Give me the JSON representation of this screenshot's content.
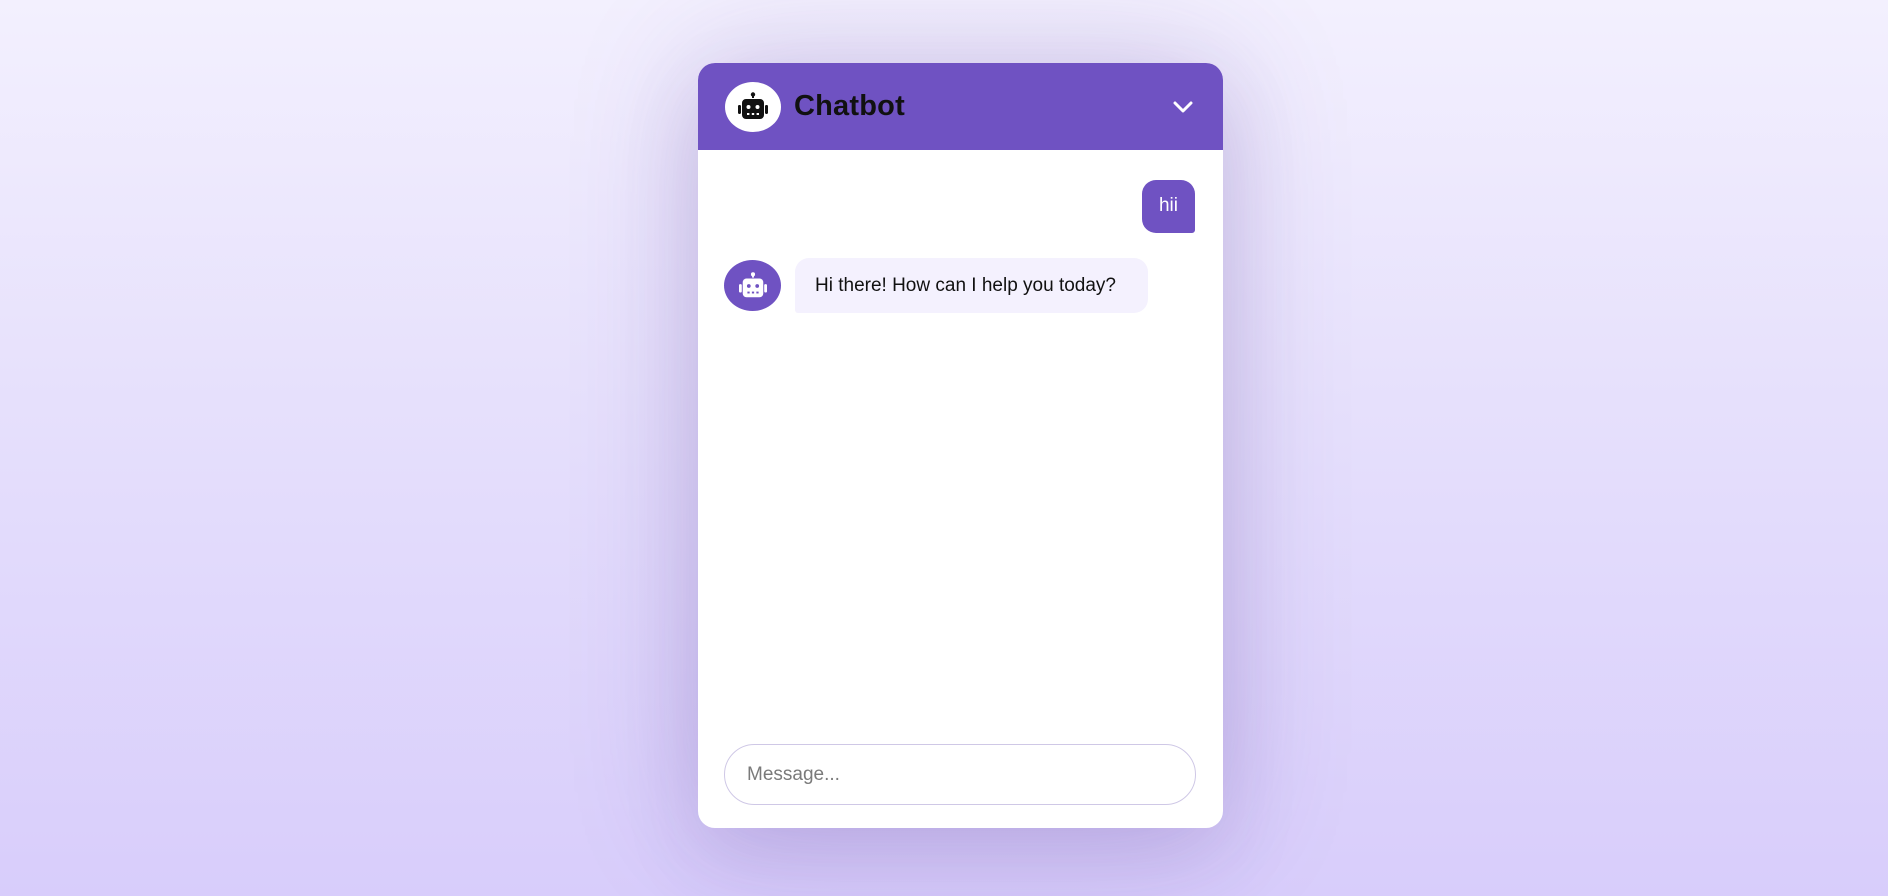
{
  "header": {
    "title": "Chatbot",
    "avatar_icon": "robot-icon",
    "toggle_icon": "chevron-down-icon"
  },
  "messages": [
    {
      "role": "user",
      "text": "hii"
    },
    {
      "role": "bot",
      "text": "Hi there! How can I help you today?",
      "avatar_icon": "robot-icon"
    }
  ],
  "composer": {
    "placeholder": "Message...",
    "value": ""
  },
  "colors": {
    "accent": "#6f52c2",
    "bot_bubble": "#f4f1fe",
    "page_background_top": "#f3f0fe",
    "page_background_bottom": "#d8cdfb"
  }
}
